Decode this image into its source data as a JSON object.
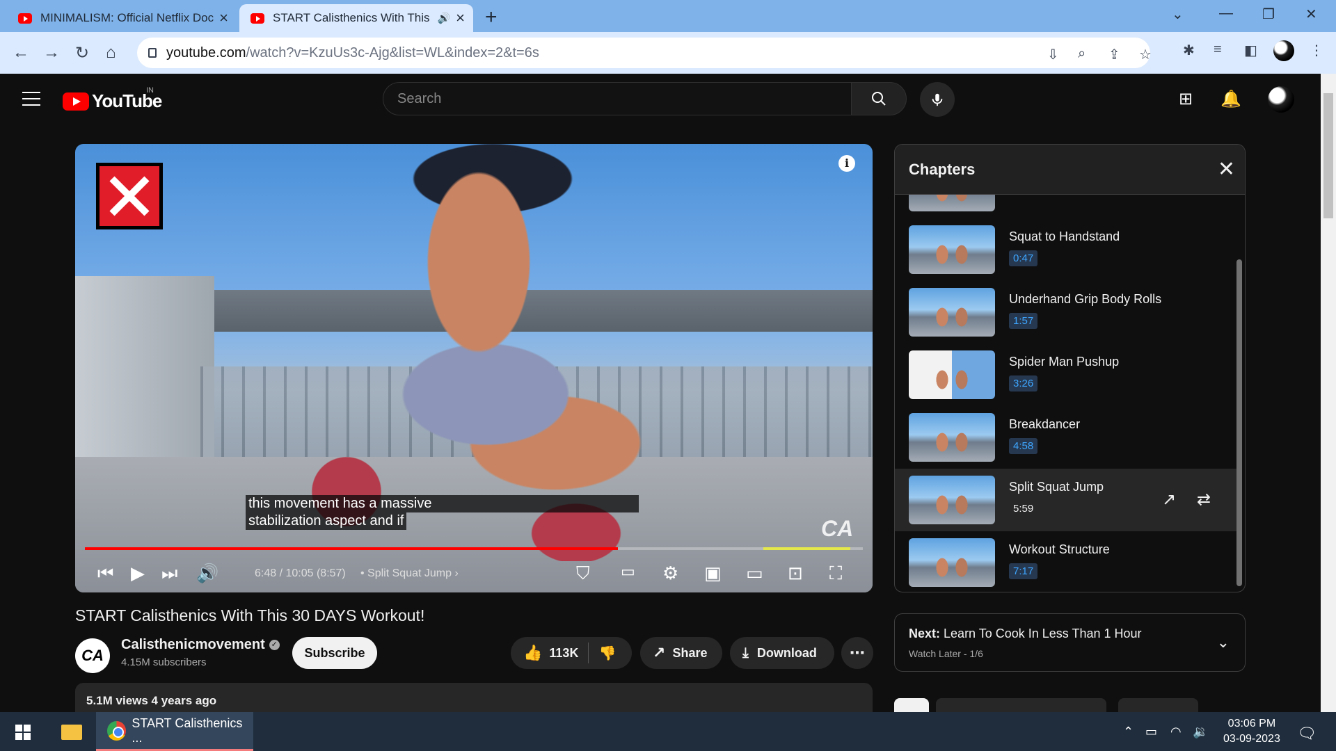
{
  "browser": {
    "tabs": [
      {
        "title": "MINIMALISM: Official Netflix Doc",
        "active": false
      },
      {
        "title": "START Calisthenics With This",
        "active": true
      }
    ],
    "url_host": "youtube.com",
    "url_path": "/watch?v=KzuUs3c-Ajg&list=WL&index=2&t=6s"
  },
  "youtube": {
    "logo_text": "YouTube",
    "country_code": "IN",
    "search_placeholder": "Search"
  },
  "player": {
    "caption_line1": "this movement has a massive",
    "caption_line2": "stabilization aspect and if",
    "timecode": "6:48 / 10:05 (8:57)",
    "current_chapter": "Split Squat Jump",
    "watermark": "CA",
    "progress_played": 0.685
  },
  "chapters_panel": {
    "title": "Chapters",
    "items": [
      {
        "title": "Squat to Handstand",
        "time": "0:47",
        "active": false
      },
      {
        "title": "Underhand Grip Body Rolls",
        "time": "1:57",
        "active": false
      },
      {
        "title": "Spider Man Pushup",
        "time": "3:26",
        "active": false
      },
      {
        "title": "Breakdancer",
        "time": "4:58",
        "active": false
      },
      {
        "title": "Split Squat Jump",
        "time": "5:59",
        "active": true
      },
      {
        "title": "Workout Structure",
        "time": "7:17",
        "active": false
      }
    ]
  },
  "video": {
    "title": "START Calisthenics With This 30 DAYS Workout!",
    "channel_name": "Calisthenicmovement",
    "channel_logo": "CA",
    "subscribers": "4.15M subscribers",
    "subscribe_label": "Subscribe",
    "likes": "113K",
    "share_label": "Share",
    "download_label": "Download",
    "views_time": "5.1M views  4 years ago"
  },
  "up_next": {
    "label": "Next:",
    "title": "Learn To Cook In Less Than 1 Hour",
    "playlist": "Watch Later - 1/6"
  },
  "taskbar": {
    "app_label": "START Calisthenics ...",
    "time": "03:06 PM",
    "date": "03-09-2023"
  },
  "colors": {
    "yt_red": "#ff0000",
    "chapter_time_blue": "#3ea6ff",
    "chrome_tab_bar": "#7fb2e8"
  }
}
